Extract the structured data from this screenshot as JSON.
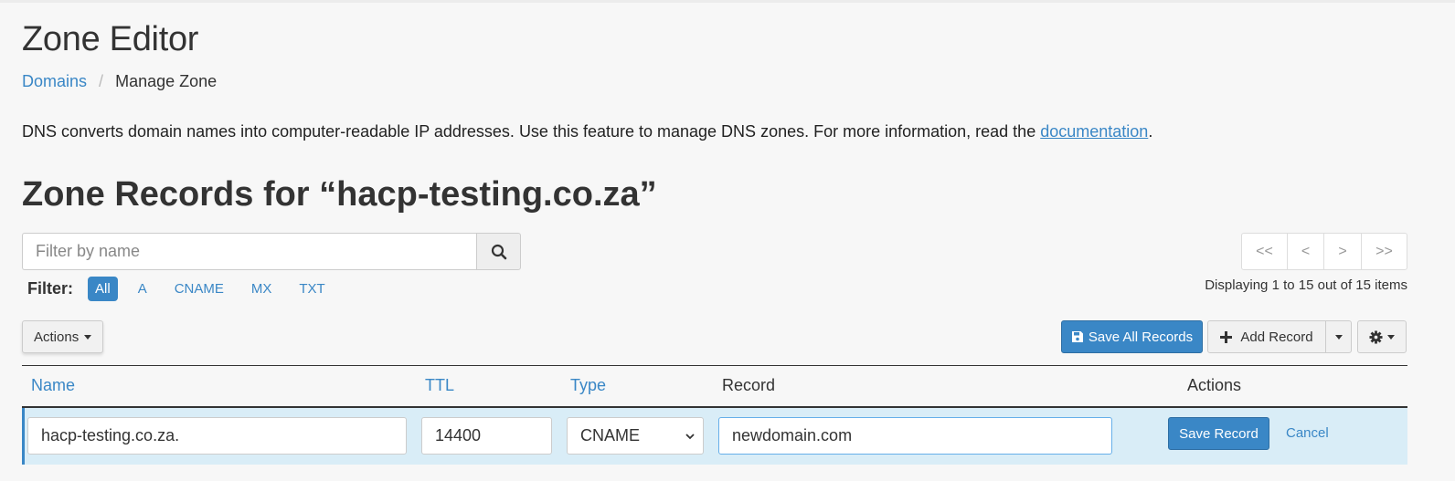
{
  "header": {
    "title": "Zone Editor",
    "breadcrumb": [
      {
        "label": "Domains",
        "link": true
      },
      {
        "label": "Manage Zone",
        "link": false
      }
    ],
    "breadcrumb_separator": "/"
  },
  "description": {
    "text": "DNS converts domain names into computer-readable IP addresses. Use this feature to manage DNS zones. For more information, read the ",
    "link_label": "documentation",
    "suffix": "."
  },
  "zone": {
    "title": "Zone Records for “hacp-testing.co.za”"
  },
  "search": {
    "placeholder": "Filter by name",
    "value": "",
    "icon": "search-icon"
  },
  "filter": {
    "label": "Filter:",
    "options": [
      "All",
      "A",
      "CNAME",
      "MX",
      "TXT"
    ],
    "active": "All"
  },
  "pagination": {
    "buttons": [
      "<<",
      "<",
      ">",
      ">>"
    ],
    "info": "Displaying 1 to 15 out of 15 items"
  },
  "toolbar": {
    "actions_label": "Actions",
    "save_all_label": "Save All Records",
    "add_record_label": "Add Record",
    "settings_icon": "gear-icon"
  },
  "table": {
    "headers": {
      "name": "Name",
      "ttl": "TTL",
      "type": "Type",
      "record": "Record",
      "actions": "Actions"
    },
    "edit_row": {
      "name": "hacp-testing.co.za.",
      "ttl": "14400",
      "type": "CNAME",
      "record": "newdomain.com",
      "save_label": "Save Record",
      "cancel_label": "Cancel"
    }
  },
  "colors": {
    "accent": "#3a87c6",
    "row_highlight": "#d9edf7",
    "background": "#f7f7f7"
  }
}
